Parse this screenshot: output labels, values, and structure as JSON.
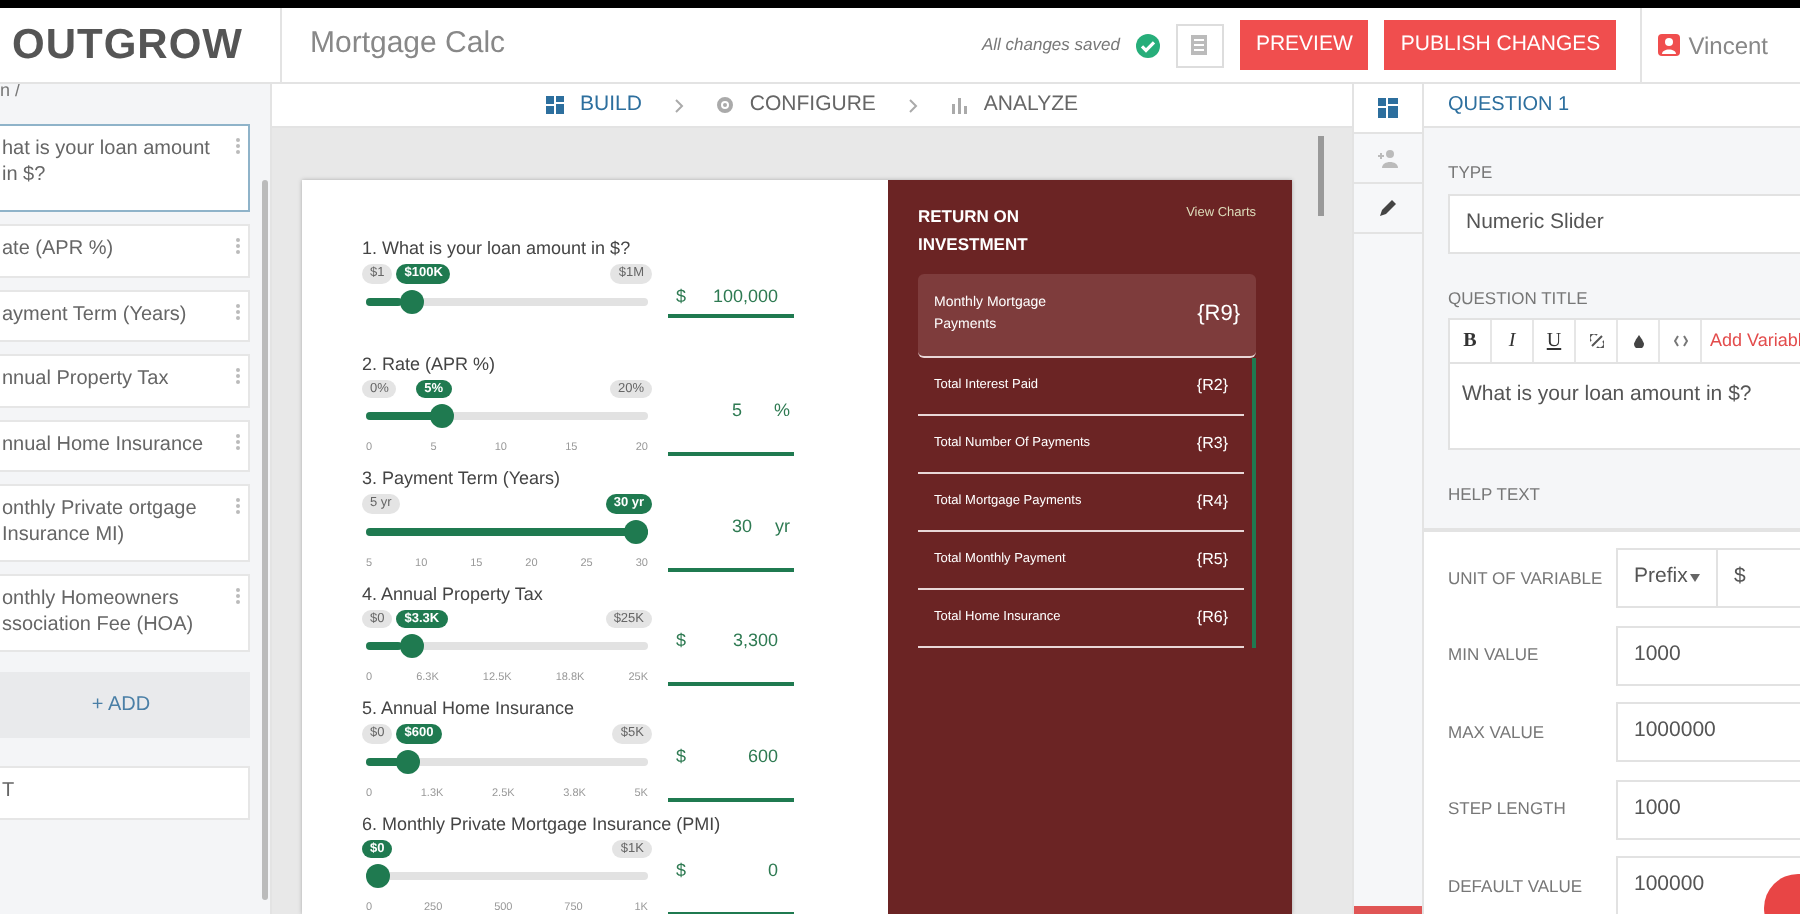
{
  "header": {
    "logo": "OUTGROW",
    "project": "Mortgage Calc",
    "save_status": "All changes saved",
    "buttons": [
      {
        "label": "PREVIEW"
      },
      {
        "label": "PUBLISH CHANGES"
      }
    ],
    "user": "Vincent"
  },
  "sidebar": {
    "top_fragment": "n /",
    "items": [
      {
        "label": "hat is your loan amount in $?",
        "selected": true
      },
      {
        "label": "ate (APR %)",
        "selected": false
      },
      {
        "label": "ayment Term (Years)",
        "selected": false
      },
      {
        "label": "nnual Property Tax",
        "selected": false
      },
      {
        "label": "nnual Home Insurance",
        "selected": false
      },
      {
        "label": "onthly Private ortgage Insurance MI)",
        "selected": false
      },
      {
        "label": "onthly Homeowners ssociation Fee (HOA)",
        "selected": false
      }
    ],
    "add_label": "+ ADD",
    "bottom_fragment": "T"
  },
  "steps": [
    {
      "label": "BUILD",
      "kind": "build",
      "selected": true
    },
    {
      "label": "CONFIGURE",
      "kind": "configure",
      "selected": false
    },
    {
      "label": "ANALYZE",
      "kind": "analyze",
      "selected": false
    }
  ],
  "preview": {
    "questions": [
      {
        "number": "1.",
        "title": "What is your loan amount in $?",
        "min": "$1",
        "current": "$100K",
        "max": "$1M",
        "level": 0.13,
        "prefix": "$",
        "value": "100,000"
      },
      {
        "number": "2.",
        "title": "Rate (APR %)",
        "min": "0%",
        "current": "5%",
        "max": "20%",
        "level": 0.25,
        "ticks": [
          "0",
          "5",
          "10",
          "15",
          "20"
        ],
        "value": "5",
        "suffix": "%"
      },
      {
        "number": "3.",
        "title": "Payment Term (Years)",
        "min": "5 yr",
        "current": "30 yr",
        "level": 1,
        "ticks": [
          "5",
          "10",
          "15",
          "20",
          "25",
          "30"
        ],
        "value": "30",
        "suffix": "yr"
      },
      {
        "number": "4.",
        "title": "Annual Property Tax",
        "min": "$0",
        "current": "$3.3K",
        "max": "$25K",
        "level": 0.13,
        "ticks": [
          "0",
          "6.3K",
          "12.5K",
          "18.8K",
          "25K"
        ],
        "prefix": "$",
        "value": "3,300"
      },
      {
        "number": "5.",
        "title": "Annual Home Insurance",
        "min": "$0",
        "current": "$600",
        "max": "$5K",
        "level": 0.12,
        "ticks": [
          "0",
          "1.3K",
          "2.5K",
          "3.8K",
          "5K"
        ],
        "prefix": "$",
        "value": "600"
      },
      {
        "number": "6.",
        "title": "Monthly Private Mortgage Insurance (PMI)",
        "current": "$0",
        "max": "$1K",
        "level": 0,
        "ticks": [
          "0",
          "250",
          "500",
          "750",
          "1K"
        ],
        "prefix": "$",
        "value": "0"
      }
    ],
    "results": {
      "title": "RETURN ON INVESTMENT",
      "link": "View Charts",
      "items": [
        {
          "label": "Monthly Mortgage Payments",
          "token": "{R9}",
          "highlighted": true
        },
        {
          "label": "Total Interest Paid",
          "token": "{R2}",
          "highlighted": false
        },
        {
          "label": "Total Number Of  Payments",
          "token": "{R3}",
          "highlighted": false
        },
        {
          "label": "Total Mortgage Payments",
          "token": "{R4}",
          "highlighted": false
        },
        {
          "label": "Total Monthly Payment",
          "token": "{R5}",
          "highlighted": false
        },
        {
          "label": "Total Home Insurance",
          "token": "{R6}",
          "highlighted": false
        }
      ]
    }
  },
  "side_tabs": [
    {
      "kind": "layout",
      "selected": true
    },
    {
      "kind": "users",
      "selected": false
    },
    {
      "kind": "edit",
      "selected": false
    }
  ],
  "panel": {
    "title": "QUESTION 1",
    "type_label": "TYPE",
    "type_value": "Numeric Slider",
    "question_title_label": "QUESTION TITLE",
    "toolbar": [
      {
        "kind": "text",
        "label": "B"
      },
      {
        "kind": "text",
        "label": "I"
      },
      {
        "kind": "text",
        "label": "U"
      },
      {
        "kind": "link"
      },
      {
        "kind": "color"
      },
      {
        "kind": "code"
      },
      {
        "kind": "variable",
        "label": "Add Variabl"
      }
    ],
    "question_text": "What is your loan amount in $?",
    "help_label": "HELP TEXT",
    "unit_label": "UNIT OF VARIABLE",
    "unit_mode": "Prefix",
    "unit_value": "$",
    "fields": [
      {
        "label": "MIN VALUE",
        "value": "1000"
      },
      {
        "label": "MAX VALUE",
        "value": "1000000"
      },
      {
        "label": "STEP LENGTH",
        "value": "1000"
      },
      {
        "label": "DEFAULT VALUE",
        "value": "100000"
      }
    ]
  }
}
